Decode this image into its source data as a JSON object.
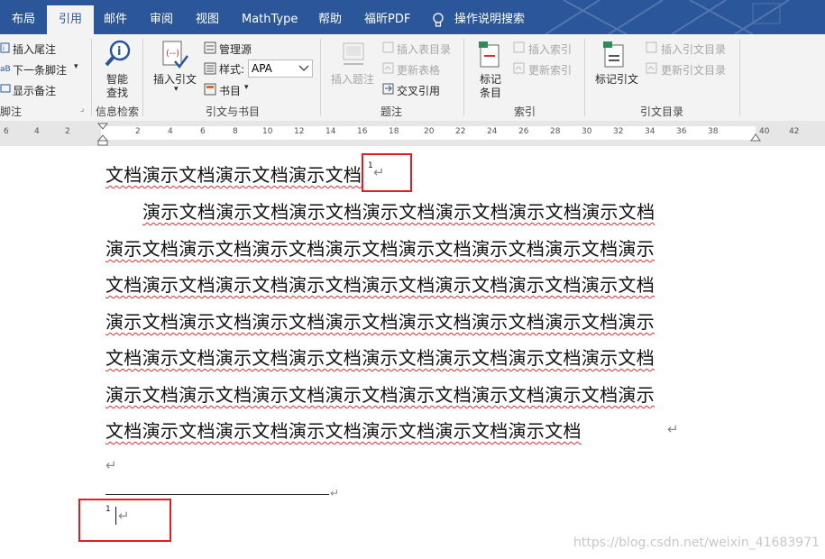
{
  "tabs": [
    "布局",
    "引用",
    "邮件",
    "审阅",
    "视图",
    "MathType",
    "帮助",
    "福昕PDF",
    "操作说明搜索"
  ],
  "ribbon": {
    "footnotes": {
      "insert_endnote": "插入尾注",
      "next_footnote": "下一条脚注",
      "show_notes": "显示备注",
      "group": "脚注"
    },
    "research": {
      "smart_lookup_1": "智能",
      "smart_lookup_2": "查找",
      "group": "信息检索"
    },
    "citations": {
      "insert_citation": "插入引文",
      "manage_sources": "管理源",
      "style_label": "样式:",
      "style_value": "APA",
      "bibliography": "书目",
      "group": "引文与书目"
    },
    "captions": {
      "insert_caption": "插入题注",
      "insert_table_of_figures": "插入表目录",
      "update_table": "更新表格",
      "cross_reference": "交叉引用",
      "group": "题注"
    },
    "index": {
      "mark_entry_1": "标记",
      "mark_entry_2": "条目",
      "insert_index": "插入索引",
      "update_index": "更新索引",
      "group": "索引"
    },
    "authorities": {
      "mark_citation": "标记引文",
      "insert_toa": "插入引文目录",
      "update_toa": "更新引文目录",
      "group": "引文目录"
    }
  },
  "ruler_numbers": [
    "6",
    "4",
    "2",
    "2",
    "4",
    "6",
    "8",
    "10",
    "12",
    "14",
    "16",
    "18",
    "20",
    "22",
    "24",
    "26",
    "28",
    "30",
    "32",
    "34",
    "36",
    "38",
    "40",
    "42"
  ],
  "document": {
    "heading": "文档演示文档演示文档演示文档",
    "footnote_ref": "1",
    "body_lines": [
      "演示文档演示文档演示文档演示文档演示文档演示文档演示文档",
      "演示文档演示文档演示文档演示文档演示文档演示文档演示文档演示",
      "文档演示文档演示文档演示文档演示文档演示文档演示文档演示文档",
      "演示文档演示文档演示文档演示文档演示文档演示文档演示文档演示",
      "文档演示文档演示文档演示文档演示文档演示文档演示文档演示文档",
      "演示文档演示文档演示文档演示文档演示文档演示文档演示文档演示",
      "文档演示文档演示文档演示文档演示文档演示文档演示文档"
    ],
    "paragraph_mark": "↵",
    "footnote_number": "1"
  },
  "watermark": "https://blog.csdn.net/weixin_41683971",
  "colors": {
    "tab_bar": "#2b579a",
    "ribbon": "#f3f3f3",
    "highlight_box": "#e02020",
    "spell_underline": "#e03030"
  }
}
